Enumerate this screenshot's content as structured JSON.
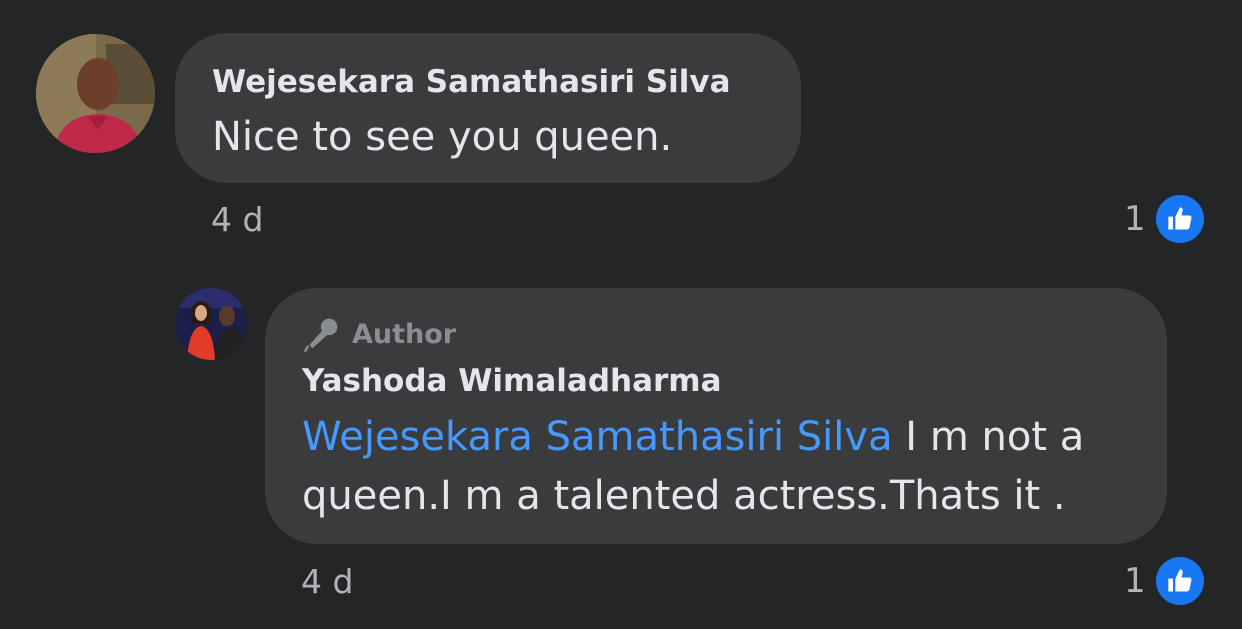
{
  "comment": {
    "author_name": "Wejesekara Samathasiri Silva",
    "text": "Nice to see you queen.",
    "time": "4 d",
    "like_count": "1",
    "avatar_icon": "profile-photo-man-red-shirt"
  },
  "reply": {
    "badge_label": "Author",
    "badge_icon": "microphone-icon",
    "author_name": "Yashoda Wimaladharma",
    "mention": "Wejesekara Samathasiri Silva",
    "text": " I m not a queen.I m a talented actress.Thats it .",
    "time": "4 d",
    "like_count": "1",
    "avatar_icon": "profile-photo-woman-red-dress"
  },
  "colors": {
    "background": "#242526",
    "bubble": "#3a3b3c",
    "mention": "#4599ff",
    "like_badge": "#1877f2"
  }
}
